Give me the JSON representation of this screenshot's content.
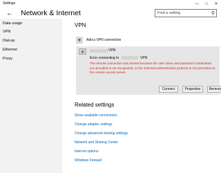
{
  "window": {
    "title": "Settings",
    "controls": [
      "—",
      "□",
      "✕"
    ]
  },
  "header": {
    "title": "Network & Internet",
    "search_placeholder": "Find a setting"
  },
  "sidebar": {
    "items": [
      {
        "label": "Data usage"
      },
      {
        "label": "VPN"
      },
      {
        "label": "Dial-up"
      },
      {
        "label": "Ethernet"
      },
      {
        "label": "Proxy"
      }
    ]
  },
  "main": {
    "section_title": "VPN",
    "add_vpn_label": "Add a VPN connection",
    "vpn_entry": {
      "name_suffix": "VPN",
      "error_prefix": "Error connecting to",
      "error_suffix": "VPN",
      "error_message": "The remote connection was denied because the user name and password combination you provided is not recognized, or the selected authentication protocol is not permitted on the remote access server.",
      "buttons": {
        "connect": "Connect",
        "properties": "Properties",
        "remove": "Remove"
      }
    },
    "related_title": "Related settings",
    "related_links": [
      {
        "label": "Show available connections"
      },
      {
        "label": "Change adapter settings"
      },
      {
        "label": "Change advanced sharing settings"
      },
      {
        "label": "Network and Sharing Center"
      },
      {
        "label": "Internet options"
      },
      {
        "label": "Windows Firewall"
      }
    ]
  },
  "colors": {
    "accent": "#0063b1",
    "error": "#c42b1c",
    "sidebar_bg": "#f2f2f2",
    "card_bg": "#e6e6e6"
  }
}
